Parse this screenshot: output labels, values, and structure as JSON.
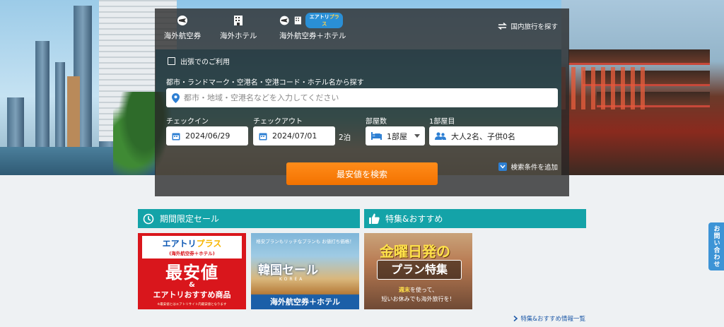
{
  "search": {
    "tabs": [
      {
        "label": "海外航空券",
        "icon": "globe-plane-icon"
      },
      {
        "label": "海外ホテル",
        "icon": "building-icon"
      },
      {
        "label": "海外航空券＋ホテル",
        "icon": "globe-plane-building-icon",
        "badge_a": "エアトリ",
        "badge_b": "プラス"
      }
    ],
    "domestic_link": "国内旅行を探す",
    "business_trip": "出張でのご利用",
    "destination_label": "都市・ランドマーク・空港名・空港コード・ホテル名から探す",
    "destination_placeholder": "都市・地域・空港名などを入力してください",
    "checkin_label": "チェックイン",
    "checkin_value": "2024/06/29",
    "checkout_label": "チェックアウト",
    "checkout_value": "2024/07/01",
    "nights": "2泊",
    "rooms_label": "部屋数",
    "rooms_value": "1部屋",
    "guests_label": "1部屋目",
    "guests_value": "大人2名、子供0名",
    "add_conditions": "検索条件を追加",
    "search_button": "最安値を検索"
  },
  "sections": {
    "sale_title": "期間限定セール",
    "feature_title": "特集&おすすめ",
    "more_link": "特集&おすすめ情報一覧"
  },
  "banners": {
    "b1": {
      "brand_a": "エアトリ",
      "brand_b": "プラス",
      "subtitle": "(海外航空券＋ホテル)",
      "headline": "最安値",
      "amp": "&",
      "sub": "エアトリおすすめ商品",
      "note": "※最安値とはエアトリサイト内最安値となります"
    },
    "b2": {
      "tagline": "格安プランもリッチなプランも お値打ち価格！",
      "headline": "韓国セール",
      "korea": "KOREA",
      "bottom": "海外航空券＋ホテル"
    },
    "b3": {
      "line1": "金曜日発の",
      "line2": "プラン特集",
      "line3_a": "週末",
      "line3_b": "を使って、",
      "line4": "短いお休みでも海外旅行を！"
    }
  },
  "contact_tab": "お問い合わせ",
  "colors": {
    "panel_bg": "#282828",
    "search_button": "#f37200",
    "section_header": "#14a3a8",
    "accent_blue": "#2d7fd3"
  }
}
